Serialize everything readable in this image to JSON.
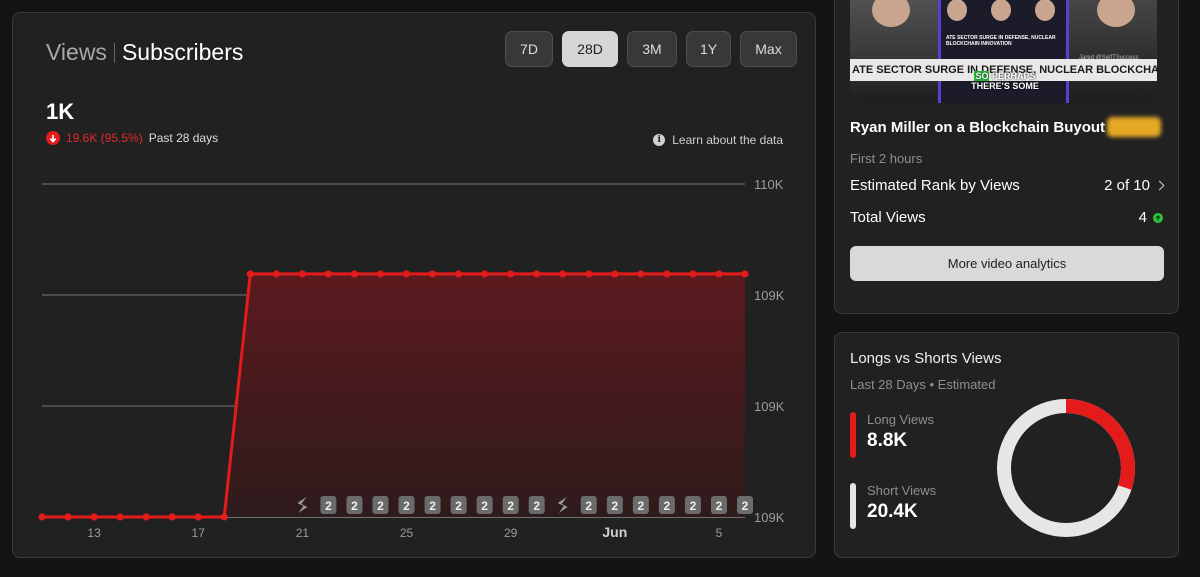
{
  "main": {
    "tab_views": "Views",
    "tab_subscribers": "Subscribers",
    "ranges": [
      "7D",
      "28D",
      "3M",
      "1Y",
      "Max"
    ],
    "active_range": "28D",
    "big_value": "1K",
    "delta_value": "19.6K (95.5%)",
    "delta_period": "Past 28 days",
    "learn_text": "Learn about the data",
    "shorts_badge_label": "2",
    "colors": {
      "accent": "#e41b1b",
      "fill": "#5a1c1f"
    }
  },
  "chart_data": {
    "type": "area",
    "y_tick_labels": [
      "110K",
      "109K",
      "109K",
      "109K"
    ],
    "x_tick_labels": [
      "13",
      "17",
      "21",
      "25",
      "29",
      "Jun",
      "5"
    ],
    "series_levels": [
      0,
      0,
      0,
      0,
      0,
      0,
      0,
      0,
      1,
      1,
      1,
      1,
      1,
      1,
      1,
      1,
      1,
      1,
      1,
      1,
      1,
      1,
      1,
      1,
      1,
      1,
      1,
      1
    ],
    "ylim": [
      0,
      1.37
    ],
    "grid": true,
    "legend": "none"
  },
  "video": {
    "banner_text": "ATE SECTOR SURGE IN DEFENSE, NUCLEAR   BLOCKCHAIN INNOVATION   UCLEAR",
    "mini_text": "ATE SECTOR SURGE IN DEFENSE, NUCLEAR BLOCKCHAIN INNOVATION",
    "caption_highlight": "SO",
    "caption_rest": "PERHAPS",
    "caption_line2": "THERE'S SOME",
    "handle": "Jared @SelfTSuccess",
    "title": "Ryan Miller on a Blockchain Buyout",
    "subtitle": "First 2 hours",
    "rank_label": "Estimated Rank by Views",
    "rank_value": "2 of 10",
    "total_label": "Total Views",
    "total_value": "4",
    "more_button": "More video analytics"
  },
  "donut": {
    "title": "Longs vs Shorts Views",
    "subtitle": "Last 28 Days • Estimated",
    "long_label": "Long Views",
    "long_value": "8.8K",
    "short_label": "Short Views",
    "short_value": "20.4K",
    "long_share": 0.301,
    "long_color": "#e41b1b",
    "short_color": "#e6e6e6"
  }
}
